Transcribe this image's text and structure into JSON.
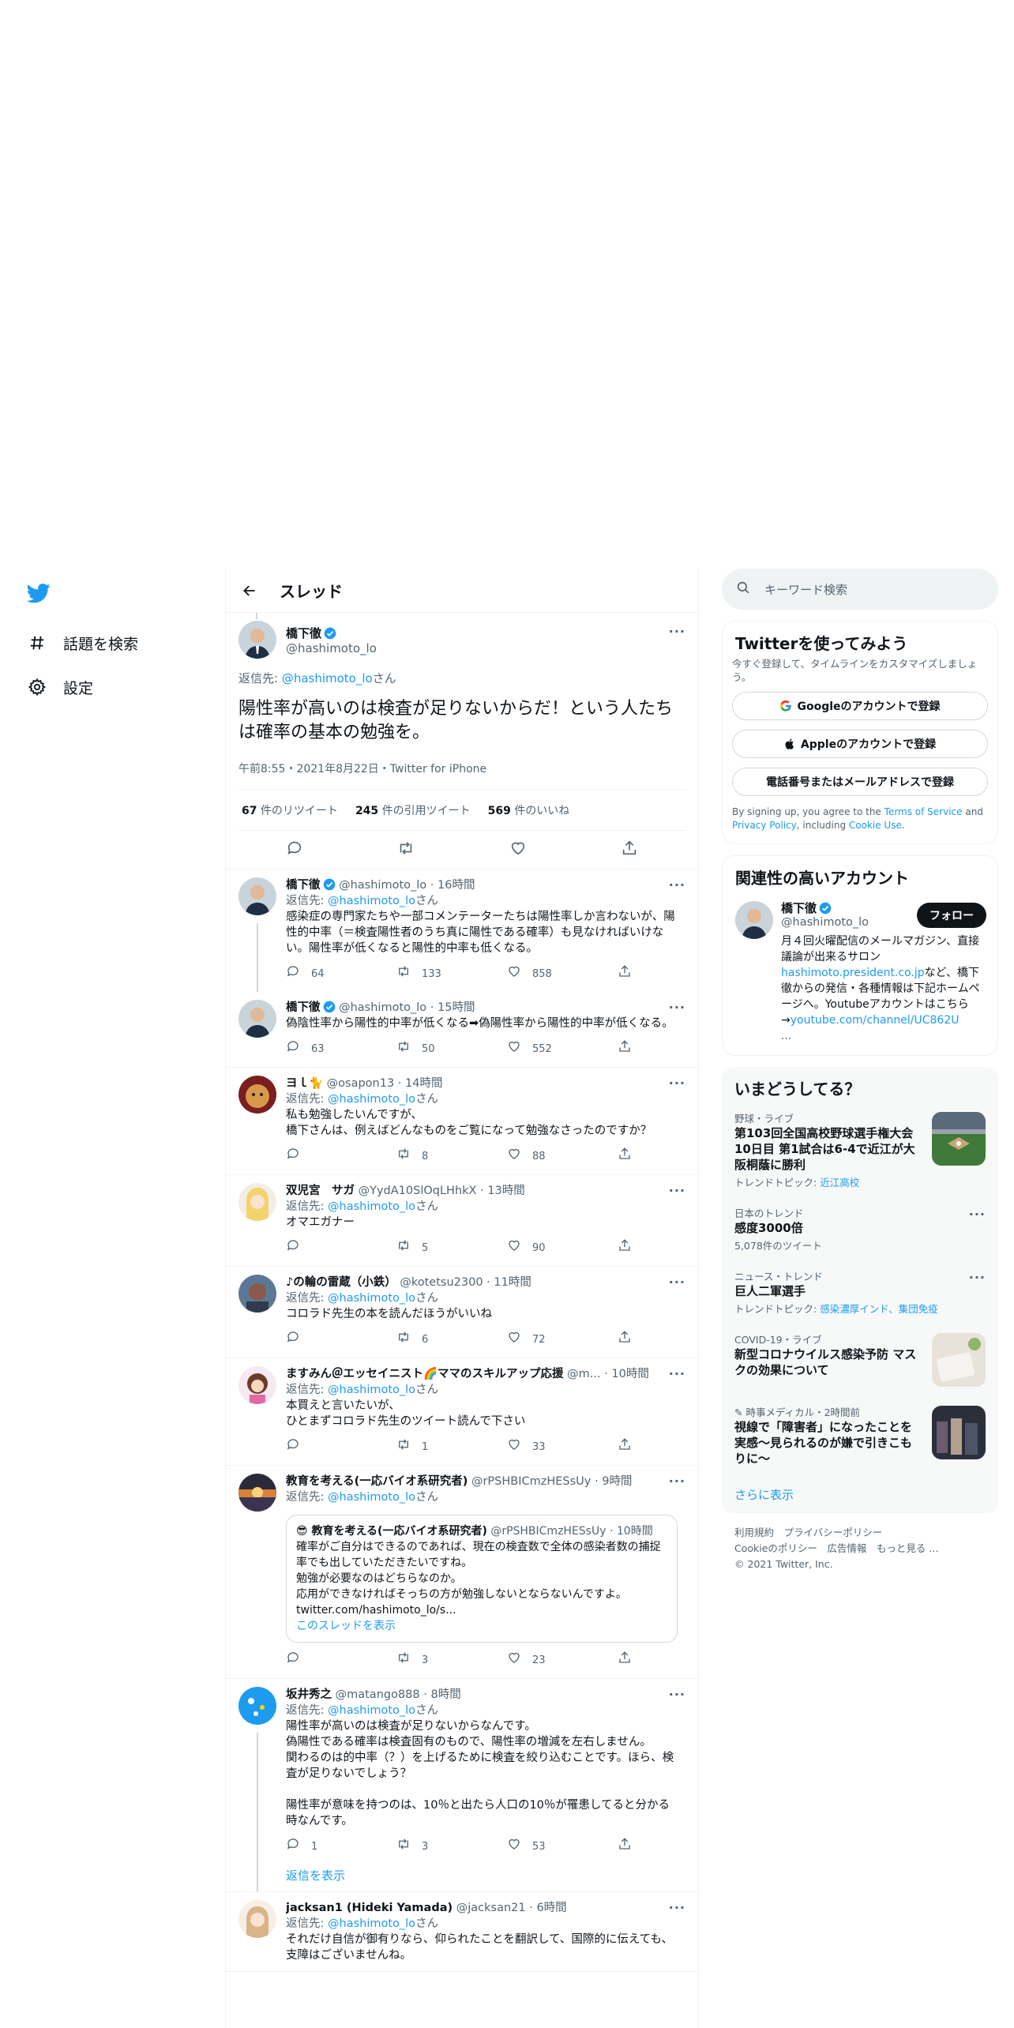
{
  "nav": {
    "items": [
      {
        "icon": "hashtag-icon",
        "label": "話題を検索"
      },
      {
        "icon": "gear-icon",
        "label": "設定"
      }
    ]
  },
  "header": {
    "title": "スレッド"
  },
  "main_tweet": {
    "name": "橋下徹",
    "handle": "@hashimoto_lo",
    "reply_prefix": "返信先: ",
    "reply_to": "@hashimoto_lo",
    "reply_suffix": "さん",
    "text": "陽性率が高いのは検査が足りないからだ！という人たちは確率の基本の勉強を。",
    "meta": "午前8:55・2021年8月22日・Twitter for iPhone",
    "retweets_n": "67",
    "retweets_l": " 件のリツイート",
    "quotes_n": "245",
    "quotes_l": " 件の引用ツイート",
    "likes_n": "569",
    "likes_l": " 件のいいね"
  },
  "replies": [
    {
      "name": "橋下徹",
      "handle": "@hashimoto_lo",
      "time": "16時間",
      "reply_to": "@hashimoto_lo",
      "text": "感染症の専門家たちや一部コメンテーターたちは陽性率しか言わないが、陽性的中率（＝検査陽性者のうち真に陽性である確率）も見なければいけない。陽性率が低くなると陽性的中率も低くなる。",
      "replies": "64",
      "retweets": "133",
      "likes": "858"
    },
    {
      "name": "橋下徹",
      "handle": "@hashimoto_lo",
      "time": "15時間",
      "reply_to": "",
      "text": "偽陰性率から陽性的中率が低くなる➡偽陽性率から陽性的中率が低くなる。",
      "replies": "63",
      "retweets": "50",
      "likes": "552"
    },
    {
      "name": "ヨｌ🐈",
      "handle": "@osapon13",
      "time": "14時間",
      "reply_to": "@hashimoto_lo",
      "text": "私も勉強したいんですが、\n橋下さんは、例えばどんなものをご覧になって勉強なさったのですか？",
      "replies": "",
      "retweets": "8",
      "likes": "88"
    },
    {
      "name": "双児宮　サガ",
      "handle": "@YydA10SlOqLHhkX",
      "time": "13時間",
      "reply_to": "@hashimoto_lo",
      "text": "オマエガナー",
      "replies": "",
      "retweets": "5",
      "likes": "90"
    },
    {
      "name": "♪の輪の雷蔵（小鉄）",
      "handle": "@kotetsu2300",
      "time": "11時間",
      "reply_to": "@hashimoto_lo",
      "text": "コロラド先生の本を読んだほうがいいね",
      "replies": "",
      "retweets": "6",
      "likes": "72"
    },
    {
      "name": "ますみん＠エッセイニスト🌈ママのスキルアップ応援",
      "handle": "@m...",
      "time": "10時間",
      "reply_to": "@hashimoto_lo",
      "text": "本買えと言いたいが、\nひとまずコロラド先生のツイート読んで下さい",
      "replies": "",
      "retweets": "1",
      "likes": "33"
    },
    {
      "name": "教育を考える(一応バイオ系研究者)",
      "handle": "@rPSHBICmzHESsUy",
      "time": "9時間",
      "reply_to": "@hashimoto_lo",
      "text": "",
      "replies": "",
      "retweets": "3",
      "likes": "23",
      "quote": {
        "name": "😎 教育を考える(一応バイオ系研究者)",
        "handle": "@rPSHBICmzHESsUy",
        "time": "10時間",
        "text": "確率がご自分はできるのであれば、現在の検査数で全体の感染者数の捕捉率でも出していただきたいですね。\n勉強が必要なのはどちらなのか。\n応用ができなければそっちの方が勉強しないとならないんですよ。\ntwitter.com/hashimoto_lo/s...",
        "link": "このスレッドを表示"
      }
    },
    {
      "name": "坂井秀之",
      "handle": "@matango888",
      "time": "8時間",
      "reply_to": "@hashimoto_lo",
      "text": "陽性率が高いのは検査が足りないからなんです。\n偽陽性である確率は検査固有のもので、陽性率の増減を左右しません。\n関わるのは的中率（？）を上げるために検査を絞り込むことです。ほら、検査が足りないでしょう？\n\n陽性率が意味を持つのは、10％と出たら人口の10％が罹患してると分かる時なんです。",
      "replies": "1",
      "retweets": "3",
      "likes": "53",
      "show_replies": "返信を表示"
    },
    {
      "name": "jacksan1 (Hideki Yamada)",
      "handle": "@jacksan21",
      "time": "6時間",
      "reply_to": "@hashimoto_lo",
      "text": "それだけ自信が御有りなら、仰られたことを翻訳して、国際的に伝えても、支障はございませんね。",
      "replies": "",
      "retweets": "",
      "likes": ""
    }
  ],
  "reply_prefix": "返信先: ",
  "reply_suffix": "さん",
  "search": {
    "placeholder": "キーワード検索"
  },
  "signup": {
    "title": "Twitterを使ってみよう",
    "subtitle": "今すぐ登録して、タイムラインをカスタマイズしましょう。",
    "google": "Googleのアカウントで登録",
    "apple": "Appleのアカウントで登録",
    "phone": "電話番号またはメールアドレスで登録",
    "legal_1": "By signing up, you agree to the ",
    "tos": "Terms of Service",
    "legal_2": " and ",
    "privacy": "Privacy Policy",
    "legal_3": ", including ",
    "cookie": "Cookie Use",
    "legal_4": "."
  },
  "related": {
    "title": "関連性の高いアカウント",
    "name": "橋下徹",
    "handle": "@hashimoto_lo",
    "follow": "フォロー",
    "bio_1": "月４回火曜配信のメールマガジン、直接議論が出来るサロン",
    "bio_link1": "hashimoto.president.co.jp",
    "bio_2": "など、橋下徹からの発信・各種情報は下記ホームページへ。Youtubeアカウントはこちら→",
    "bio_link2": "youtube.com/channel/UC862U",
    "bio_3": "..."
  },
  "trends": {
    "title": "いまどうしてる？",
    "items": [
      {
        "cat": "野球・ライブ",
        "name": "第103回全国高校野球選手権大会10日目 第1試合は6-4で近江が大阪桐蔭に勝利",
        "sub_prefix": "トレンドトピック: ",
        "sub_link": "近江高校"
      },
      {
        "cat": "日本のトレンド",
        "name": "感度3000倍",
        "sub": "5,078件のツイート"
      },
      {
        "cat": "ニュース・トレンド",
        "name": "巨人二軍選手",
        "sub_prefix": "トレンドトピック: ",
        "sub_link": "感染濃厚インド、集団免疫"
      },
      {
        "cat": "COVID-19・ライブ",
        "name": "新型コロナウイルス感染予防 マスクの効果について"
      },
      {
        "cat": "時事メディカル・2時間前",
        "name": "視線で「障害者」になったことを実感～見られるのが嫌で引きこもりに～"
      }
    ],
    "more": "さらに表示"
  },
  "footer": {
    "line1": "利用規約　プライバシーポリシー",
    "line2": "Cookieのポリシー　広告情報　もっと見る ...",
    "line3": "© 2021 Twitter, Inc."
  },
  "colors": {
    "accent": "#1d9bf0",
    "muted": "#536471",
    "border": "#eff3f4"
  }
}
